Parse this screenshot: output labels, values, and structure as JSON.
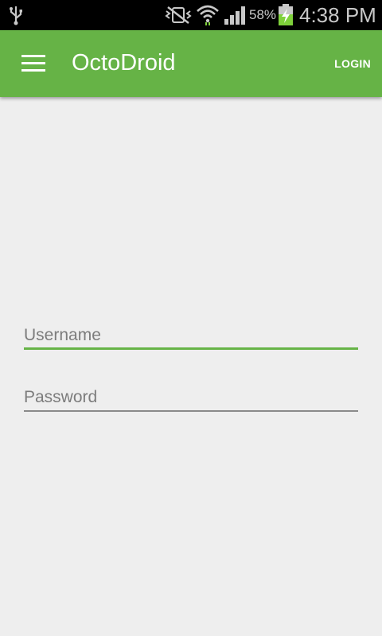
{
  "status_bar": {
    "battery_percent": "58%",
    "time": "4:38 PM",
    "icons": [
      "usb-icon",
      "vibrate-mute-icon",
      "wifi-icon",
      "signal-icon",
      "battery-charging-icon"
    ]
  },
  "app_bar": {
    "title": "OctoDroid",
    "action_label": "LOGIN",
    "menu_icon": "hamburger-menu-icon",
    "color": "#66b346"
  },
  "form": {
    "username": {
      "placeholder": "Username",
      "value": ""
    },
    "password": {
      "placeholder": "Password",
      "value": ""
    }
  },
  "colors": {
    "accent": "#66b346",
    "background": "#eeeeee"
  }
}
